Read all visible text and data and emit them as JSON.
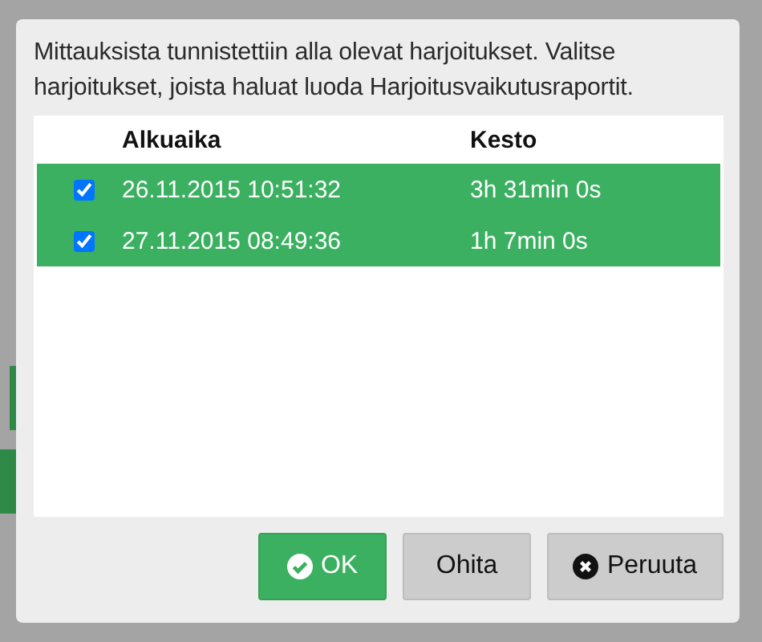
{
  "dialog": {
    "message": "Mittauksista tunnistettiin alla olevat harjoitukset. Valitse harjoitukset, joista haluat luoda Harjoitusvaikutusraportit.",
    "table": {
      "columns": [
        "Alkuaika",
        "Kesto"
      ],
      "rows": [
        {
          "checked": true,
          "selected": true,
          "start": "26.11.2015 10:51:32",
          "duration": "3h 31min 0s"
        },
        {
          "checked": true,
          "selected": true,
          "start": "27.11.2015 08:49:36",
          "duration": "1h 7min 0s"
        }
      ]
    },
    "buttons": [
      {
        "kind": "ok",
        "label": "OK"
      },
      {
        "kind": "skip",
        "label": "Ohita"
      },
      {
        "kind": "cancel",
        "label": "Peruuta"
      }
    ]
  }
}
